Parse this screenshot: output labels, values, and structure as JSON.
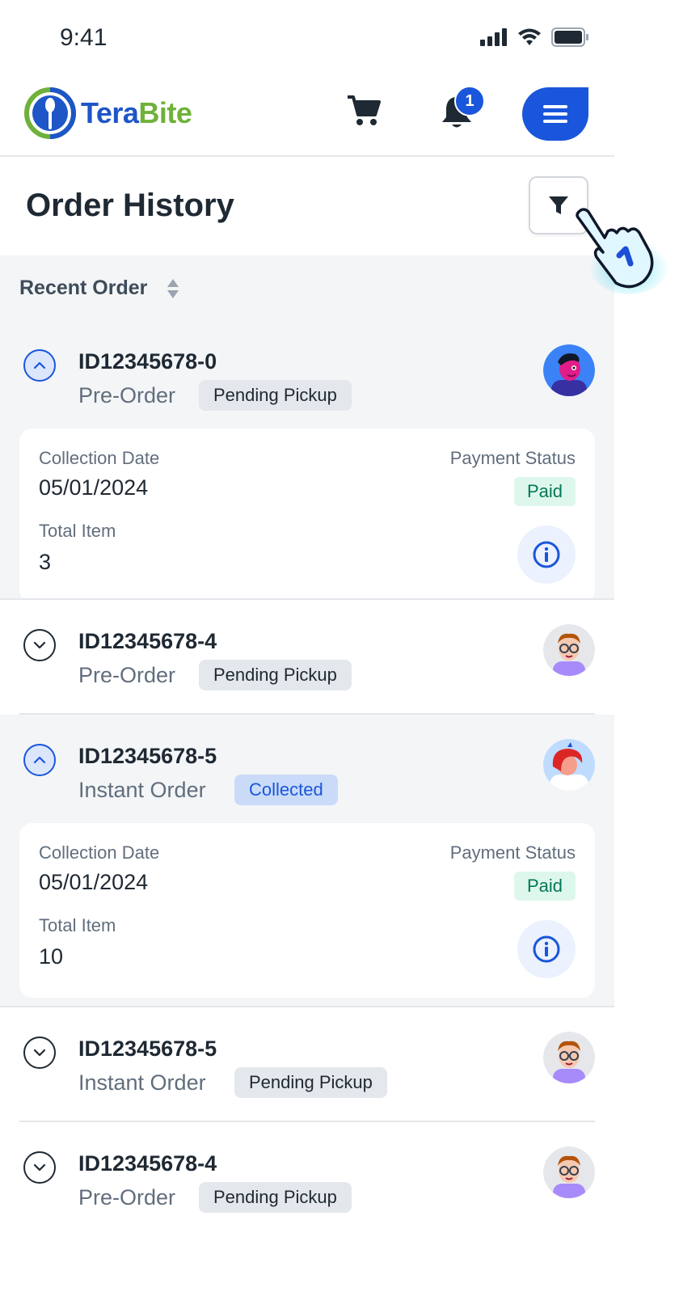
{
  "status_bar": {
    "time": "9:41"
  },
  "header": {
    "logo_part1": "Tera",
    "logo_part2": "Bite",
    "notification_count": "1"
  },
  "page": {
    "title": "Order History"
  },
  "sort": {
    "label": "Recent Order"
  },
  "orders": [
    {
      "id": "ID12345678-0",
      "type": "Pre-Order",
      "status": "Pending Pickup",
      "expanded": true,
      "collection_label": "Collection Date",
      "collection_date": "05/01/2024",
      "payment_label": "Payment Status",
      "payment_status": "Paid",
      "total_label": "Total Item",
      "total_items": "3",
      "avatar": "avatar-pink"
    },
    {
      "id": "ID12345678-4",
      "type": "Pre-Order",
      "status": "Pending Pickup",
      "expanded": false,
      "avatar": "avatar-glasses"
    },
    {
      "id": "ID12345678-5",
      "type": "Instant Order",
      "status": "Collected",
      "expanded": true,
      "collection_label": "Collection Date",
      "collection_date": "05/01/2024",
      "payment_label": "Payment Status",
      "payment_status": "Paid",
      "total_label": "Total Item",
      "total_items": "10",
      "avatar": "avatar-redhair"
    },
    {
      "id": "ID12345678-5",
      "type": "Instant Order",
      "status": "Pending Pickup",
      "expanded": false,
      "avatar": "avatar-glasses"
    },
    {
      "id": "ID12345678-4",
      "type": "Pre-Order",
      "status": "Pending Pickup",
      "expanded": false,
      "avatar": "avatar-glasses"
    }
  ],
  "colors": {
    "primary": "#1a56db",
    "logo_green": "#6fb13a",
    "paid_bg": "#def7ec",
    "paid_text": "#047857"
  }
}
